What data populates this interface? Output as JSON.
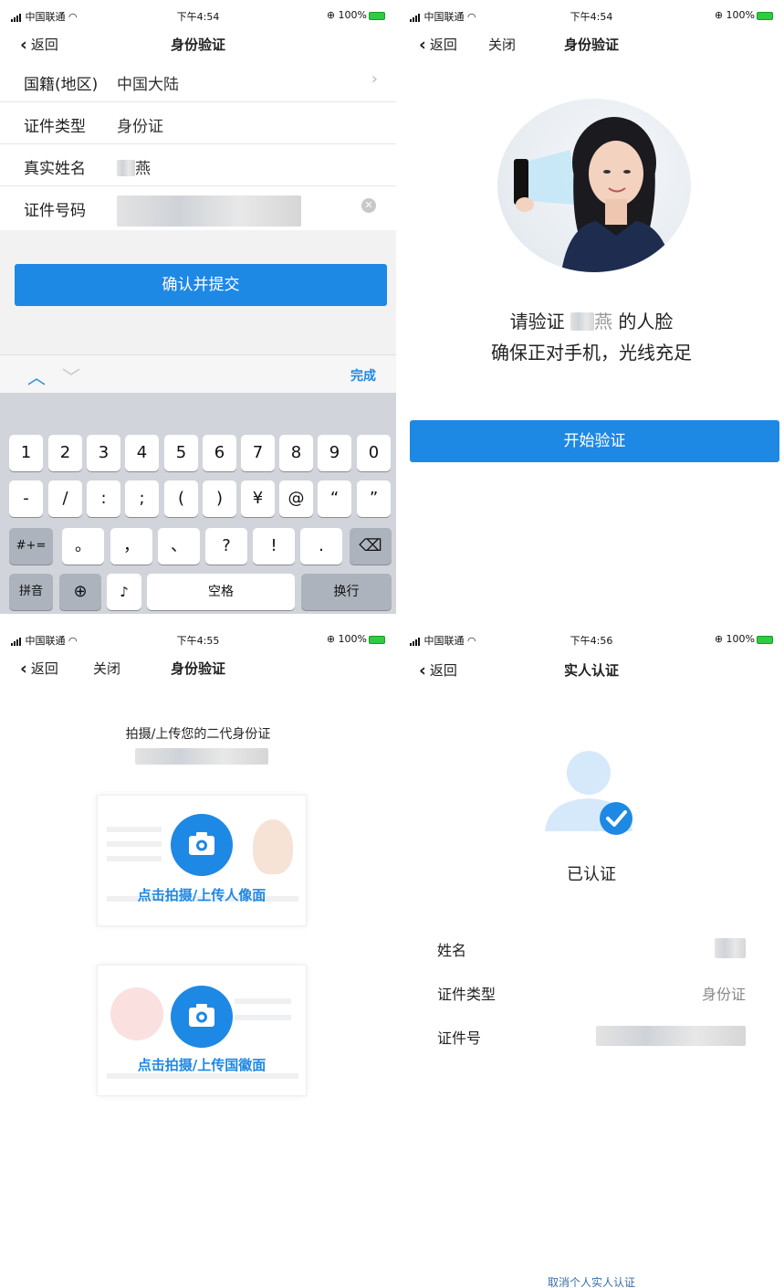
{
  "status": {
    "carrier": "中国联通",
    "time_p1": "下午4:54",
    "time_p2": "下午4:54",
    "time_p3": "下午4:55",
    "time_p4": "下午4:56",
    "battery": "100%"
  },
  "panel1": {
    "back": "返回",
    "title": "身份验证",
    "rows": [
      {
        "label": "国籍(地区)",
        "value": "中国大陆"
      },
      {
        "label": "证件类型",
        "value": "身份证"
      },
      {
        "label": "真实姓名",
        "value": "燕"
      },
      {
        "label": "证件号码",
        "value": ""
      }
    ],
    "submit": "确认并提交",
    "toolbar_done": "完成",
    "keys_row1": [
      "1",
      "2",
      "3",
      "4",
      "5",
      "6",
      "7",
      "8",
      "9",
      "0"
    ],
    "keys_row2": [
      "-",
      "/",
      ":",
      ";",
      "(",
      ")",
      "¥",
      "@",
      "“",
      "”"
    ],
    "keys_row3": [
      "#+=",
      "。",
      "，",
      "、",
      "?",
      "!",
      "."
    ],
    "key_pinyin": "拼音",
    "key_space": "空格",
    "key_return": "换行"
  },
  "panel2": {
    "back": "返回",
    "close": "关闭",
    "title": "身份验证",
    "prompt_line1_a": "请验证",
    "prompt_line1_name": "燕",
    "prompt_line1_b": "的人脸",
    "prompt_line2": "确保正对手机，光线充足",
    "start": "开始验证"
  },
  "panel3": {
    "back": "返回",
    "close": "关闭",
    "title": "身份验证",
    "heading": "拍摄/上传您的二代身份证",
    "portrait_label": "点击拍摄/上传人像面",
    "emblem_label": "点击拍摄/上传国徽面"
  },
  "panel4": {
    "back": "返回",
    "title": "实人认证",
    "verified": "已认证",
    "rows": [
      {
        "label": "姓名",
        "value": ""
      },
      {
        "label": "证件类型",
        "value": "身份证"
      },
      {
        "label": "证件号",
        "value": ""
      }
    ],
    "cancel": "取消个人实人认证"
  },
  "colors": {
    "accent": "#1e88e5",
    "keyboard_bg": "#d1d4da",
    "battery": "#2ecc40"
  }
}
